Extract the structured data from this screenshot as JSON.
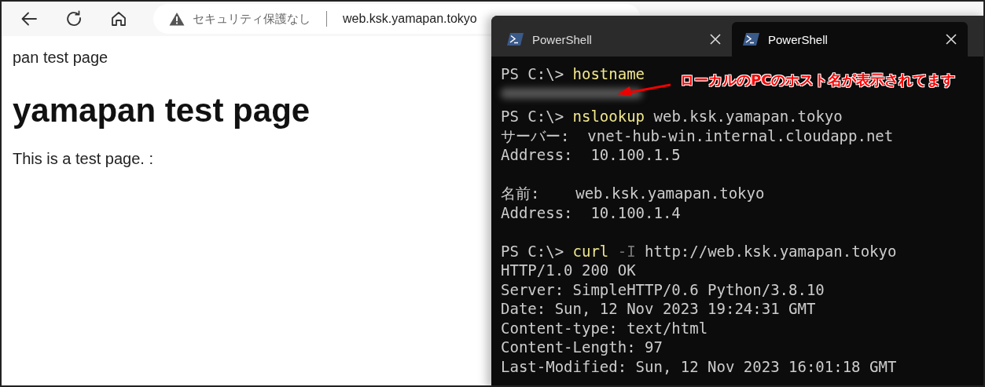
{
  "browser": {
    "address_bar": {
      "security_label": "セキュリティ保護なし",
      "url": "web.ksk.yamapan.tokyo"
    },
    "page": {
      "title_text": "pan test page",
      "heading": "yamapan test page",
      "paragraph": "This is a test page. :"
    }
  },
  "terminal": {
    "tabs": [
      {
        "label": "PowerShell",
        "selected": false
      },
      {
        "label": "PowerShell",
        "selected": true
      }
    ],
    "lines": [
      {
        "kind": "text",
        "segments": [
          {
            "kind": "prompt",
            "text": "PS C:\\>"
          },
          {
            "kind": "command",
            "text": "hostname"
          }
        ]
      },
      {
        "kind": "redacted"
      },
      {
        "kind": "text",
        "segments": [
          {
            "kind": "prompt",
            "text": "PS C:\\>"
          },
          {
            "kind": "command",
            "text": "nslookup"
          },
          {
            "kind": "output",
            "text": "web.ksk.yamapan.tokyo"
          }
        ]
      },
      {
        "kind": "text",
        "segments": [
          {
            "kind": "output",
            "text": "サーバー:  vnet-hub-win.internal.cloudapp.net"
          }
        ]
      },
      {
        "kind": "text",
        "segments": [
          {
            "kind": "output",
            "text": "Address:  10.100.1.5"
          }
        ]
      },
      {
        "kind": "blank"
      },
      {
        "kind": "text",
        "segments": [
          {
            "kind": "output",
            "text": "名前:    web.ksk.yamapan.tokyo"
          }
        ]
      },
      {
        "kind": "text",
        "segments": [
          {
            "kind": "output",
            "text": "Address:  10.100.1.4"
          }
        ]
      },
      {
        "kind": "blank"
      },
      {
        "kind": "text",
        "segments": [
          {
            "kind": "prompt",
            "text": "PS C:\\>"
          },
          {
            "kind": "command",
            "text": "curl"
          },
          {
            "kind": "parameter",
            "text": "-I"
          },
          {
            "kind": "output",
            "text": "http://web.ksk.yamapan.tokyo"
          }
        ]
      },
      {
        "kind": "text",
        "segments": [
          {
            "kind": "output",
            "text": "HTTP/1.0 200 OK"
          }
        ]
      },
      {
        "kind": "text",
        "segments": [
          {
            "kind": "output",
            "text": "Server: SimpleHTTP/0.6 Python/3.8.10"
          }
        ]
      },
      {
        "kind": "text",
        "segments": [
          {
            "kind": "output",
            "text": "Date: Sun, 12 Nov 2023 19:24:31 GMT"
          }
        ]
      },
      {
        "kind": "text",
        "segments": [
          {
            "kind": "output",
            "text": "Content-type: text/html"
          }
        ]
      },
      {
        "kind": "text",
        "segments": [
          {
            "kind": "output",
            "text": "Content-Length: 97"
          }
        ]
      },
      {
        "kind": "text",
        "segments": [
          {
            "kind": "output",
            "text": "Last-Modified: Sun, 12 Nov 2023 16:01:18 GMT"
          }
        ]
      }
    ],
    "annotation": "ローカルのPCのホスト名が表示されてます"
  }
}
